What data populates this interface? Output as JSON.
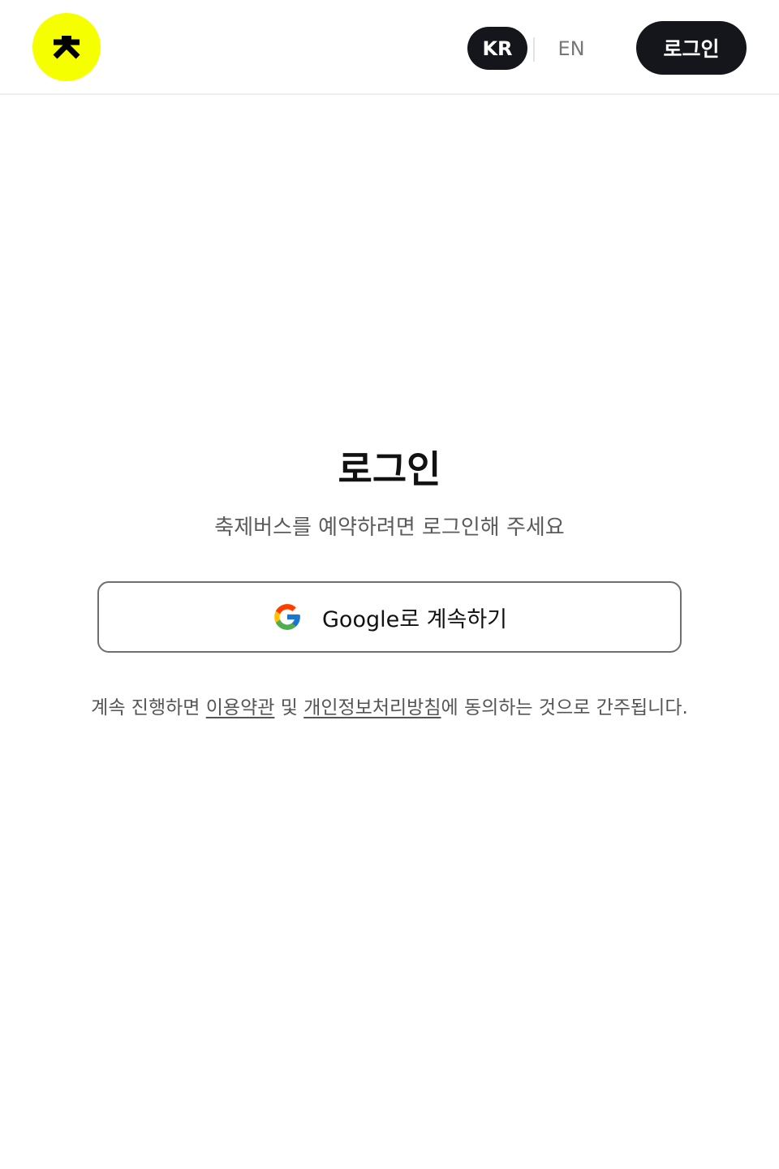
{
  "header": {
    "logo_icon": "festival-bus-logo",
    "logo_color": "#f5ff00",
    "lang_kr": "KR",
    "lang_en": "EN",
    "login_label": "로그인"
  },
  "main": {
    "title": "로그인",
    "subtitle": "축제버스를 예약하려면 로그인해 주세요",
    "google_button_label": "Google로 계속하기",
    "google_icon": "google-g-icon",
    "terms": {
      "prefix": "계속 진행하면 ",
      "terms_link": "이용약관",
      "middle": " 및 ",
      "privacy_link": "개인정보처리방침",
      "suffix": "에 동의하는 것으로 간주됩니다."
    }
  },
  "colors": {
    "accent_yellow": "#f5ff00",
    "dark": "#15161c",
    "muted_text": "#5b5b5b",
    "border": "#6e6e73"
  }
}
